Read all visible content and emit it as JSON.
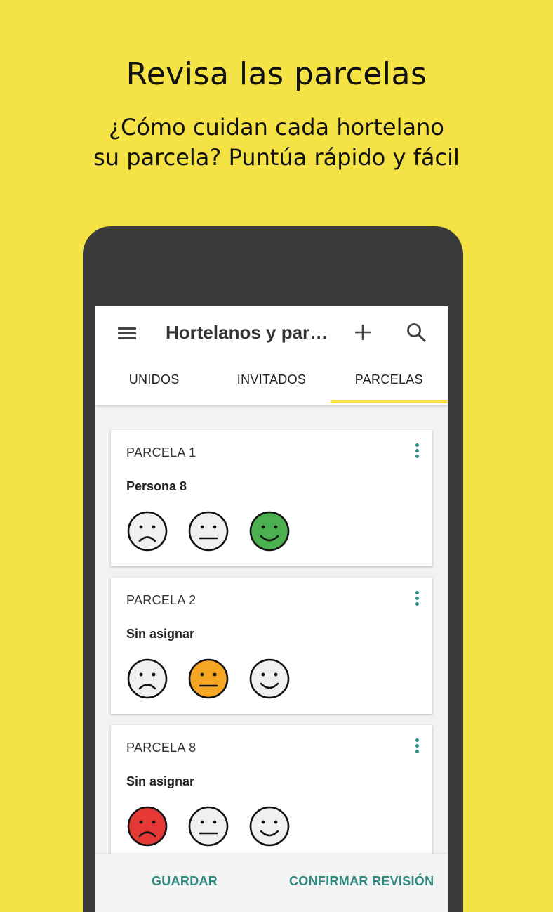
{
  "promo": {
    "headline": "Revisa las parcelas",
    "subline_1": "¿Cómo cuidan cada hortelano",
    "subline_2": "su parcela? Puntúa rápido y fácil"
  },
  "appbar": {
    "title": "Hortelanos y par…",
    "tabs": [
      {
        "label": "UNIDOS",
        "active": false
      },
      {
        "label": "INVITADOS",
        "active": false
      },
      {
        "label": "PARCELAS",
        "active": true
      }
    ]
  },
  "cards": [
    {
      "title": "PARCELA 1",
      "person": "Persona 8",
      "rating": "good"
    },
    {
      "title": "PARCELA 2",
      "person": "Sin asignar",
      "rating": "neutral"
    },
    {
      "title": "PARCELA 8",
      "person": "Sin asignar",
      "rating": "bad"
    }
  ],
  "bottombar": {
    "save_label": "GUARDAR",
    "confirm_label": "CONFIRMAR REVISIÓN"
  },
  "colors": {
    "background": "#f5e346",
    "accent": "#2e8b80",
    "good": "#4caf50",
    "neutral": "#f5a623",
    "bad": "#e53935",
    "face_default": "#f0f0f0"
  },
  "icons": {
    "menu": "menu-icon",
    "add": "add-icon",
    "search": "search-icon",
    "more": "more-vert-icon",
    "faces": [
      "sad-face-icon",
      "neutral-face-icon",
      "happy-face-icon"
    ]
  }
}
